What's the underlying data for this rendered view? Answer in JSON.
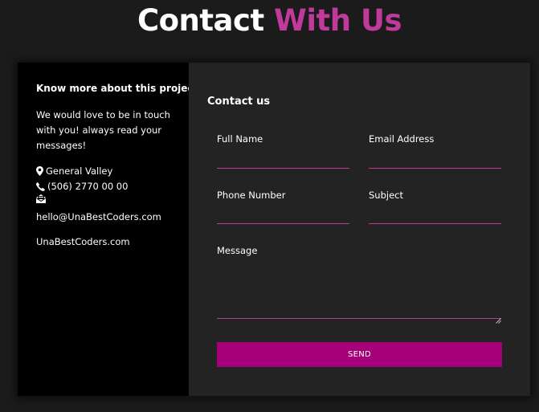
{
  "header": {
    "title_part1": "Contact",
    "title_part2": "With Us"
  },
  "info": {
    "title": "Know more about this project",
    "text": "We would love to be in touch with you! always read your messages!",
    "location": "General Valley",
    "phone": "(506) 2770 00 00",
    "email": "hello@UnaBestCoders.com",
    "website": "UnaBestCoders.com"
  },
  "form": {
    "title": "Contact us",
    "full_name_label": "Full Name",
    "full_name_value": "",
    "email_label": "Email Address",
    "email_value": "",
    "phone_label": "Phone Number",
    "phone_value": "",
    "subject_label": "Subject",
    "subject_value": "",
    "message_label": "Message",
    "message_value": "",
    "send_label": "SEND"
  },
  "colors": {
    "accent": "#c03a9b",
    "button": "#a5007a",
    "page_bg": "#1b1b1b",
    "info_bg": "#000000",
    "form_bg": "#232323"
  },
  "icons": {
    "location": "map-marker-icon",
    "phone": "phone-icon",
    "email": "envelope-open-icon"
  }
}
